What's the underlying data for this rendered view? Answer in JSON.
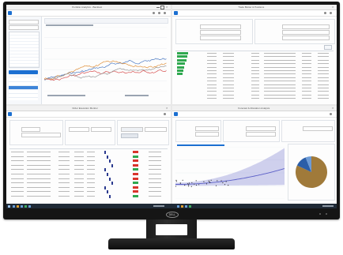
{
  "brand": {
    "monitor_logo": "DELL"
  },
  "panes": {
    "top_left": {
      "title": "Portfolio Analytics - Backtest"
    },
    "top_right": {
      "title": "Trade Blotter & Positions"
    },
    "bottom_left": {
      "title": "Order Execution Monitor"
    },
    "bottom_right": {
      "title": "Forecast & Allocation Analysis"
    }
  },
  "colors": {
    "accent": "#1b6fd1",
    "gain": "#2fa84f",
    "loss": "#d9342b",
    "forecast": "#5b5fc7",
    "pie_main": "#a07a3a",
    "pie_secondary": "#2b5ea8",
    "taskbar": "#1f2a36"
  },
  "icons": [
    "app-logo-icon",
    "search-icon",
    "settings-icon",
    "window-minimize-icon",
    "window-maximize-icon",
    "window-close-icon",
    "start-icon"
  ]
}
